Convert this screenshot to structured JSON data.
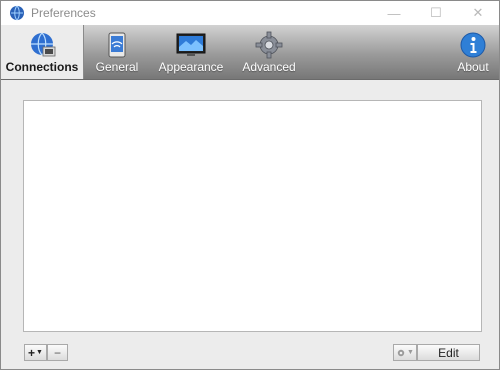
{
  "window": {
    "title": "Preferences"
  },
  "tabs": [
    {
      "label": "Connections",
      "icon": "globe-network-icon",
      "active": true
    },
    {
      "label": "General",
      "icon": "phone-signal-icon",
      "active": false
    },
    {
      "label": "Appearance",
      "icon": "monitor-icon",
      "active": false
    },
    {
      "label": "Advanced",
      "icon": "gear-icon",
      "active": false
    },
    {
      "label": "About",
      "icon": "info-icon",
      "active": false
    }
  ],
  "connections": {
    "items": []
  },
  "footer": {
    "add_label": "+",
    "remove_label": "−",
    "edit_label": "Edit"
  },
  "colors": {
    "toolbar_top": "#d2d2d2",
    "toolbar_bottom": "#777777",
    "about_blue": "#2f7fd6"
  }
}
